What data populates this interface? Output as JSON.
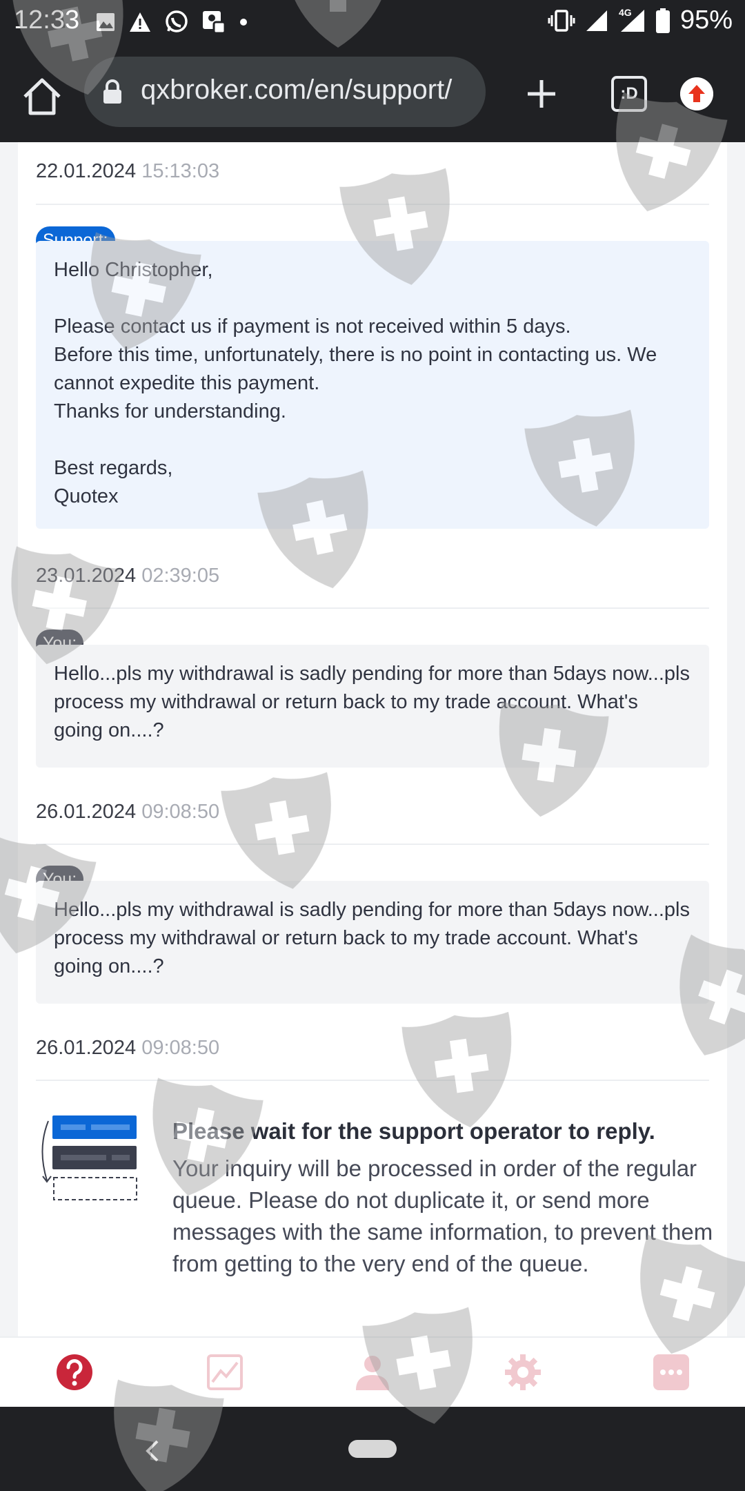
{
  "status_bar": {
    "time": "12:33",
    "network": "4G",
    "battery": "95%"
  },
  "browser": {
    "url": "qxbroker.com/en/support/",
    "tabs_label": ":D"
  },
  "messages": [
    {
      "date": "22.01.2024",
      "time": "15:13:03",
      "author": "Support:",
      "lines": [
        "Hello Christopher,",
        "",
        "Please contact us if payment is not received within 5 days.",
        "Before this time, unfortunately, there is no point in contacting us. We cannot expedite this payment.",
        "Thanks for understanding.",
        "",
        "Best regards,",
        "Quotex"
      ]
    },
    {
      "date": "23.01.2024",
      "time": "02:39:05",
      "author": "You:",
      "lines": [
        "Hello...pls my withdrawal is sadly pending for more than 5days now...pls process my withdrawal or return back to my trade account. What's going on....?"
      ]
    },
    {
      "date": "26.01.2024",
      "time": "09:08:50",
      "author": "You:",
      "lines": [
        "Hello...pls my withdrawal is sadly pending for more than 5days now...pls process my withdrawal or return back to my trade account. What's going on....?"
      ]
    }
  ],
  "notice": {
    "date": "26.01.2024",
    "time": "09:08:50",
    "title": "Please wait for the support operator to reply.",
    "text": "Your inquiry will be processed in order of the regular queue. Please do not duplicate it, or send more messages with the same information, to prevent them from getting to the very end of the queue."
  },
  "colors": {
    "support_badge": "#0b67d6",
    "you_badge": "#3b3f4d",
    "support_bubble": "#eef4fd",
    "you_bubble": "#f3f4f6",
    "nav_active": "#c9263a",
    "nav_inactive": "#f1c9cf"
  },
  "bottom_nav": [
    "help-icon",
    "chart-icon",
    "profile-icon",
    "settings-icon",
    "more-icon"
  ]
}
